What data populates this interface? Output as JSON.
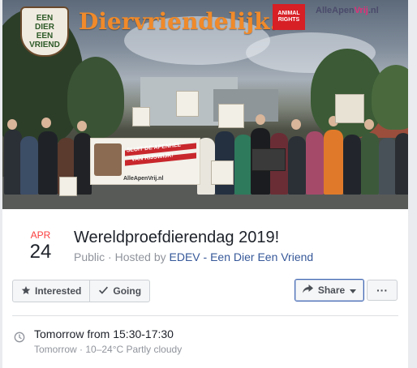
{
  "cover": {
    "brand_logo_lines": [
      "EEN",
      "DIER",
      "EEN",
      "VRIEND"
    ],
    "brand_title": "Diervriendelijk.nl",
    "animal_rights_label": "ANIMAL RIGHTS",
    "alle_apen_prefix": "AlleApen",
    "alle_apen_highlight": "Vrij",
    "alle_apen_suffix": ".nl",
    "banner_text_1": "SLUIT DE APENHEL",
    "banner_text_2": "VAN RIJSWIJK!",
    "banner_url": "AlleApenVrij.nl"
  },
  "event": {
    "month": "APR",
    "day": "24",
    "title": "Wereldproefdierendag 2019!",
    "privacy": "Public",
    "hosted_by_prefix": " · Hosted by ",
    "host": "EDEV - Een Dier Een Vriend"
  },
  "actions": {
    "interested_label": "Interested",
    "going_label": "Going",
    "share_label": "Share",
    "more_label": "···"
  },
  "time": {
    "main": "Tomorrow from 15:30-17:30",
    "sub": "Tomorrow · 10–24°C Partly cloudy"
  },
  "icons": {
    "interested": "star-icon",
    "going": "checkmark-icon",
    "share": "share-arrow-icon",
    "share_dropdown": "caret-down-icon",
    "time": "clock-icon"
  },
  "colors": {
    "month": "#fa3e3e",
    "link": "#365899",
    "share_border": "#4267b2",
    "brand_orange": "#f08a2a",
    "animal_rights_red": "#d71f26"
  }
}
